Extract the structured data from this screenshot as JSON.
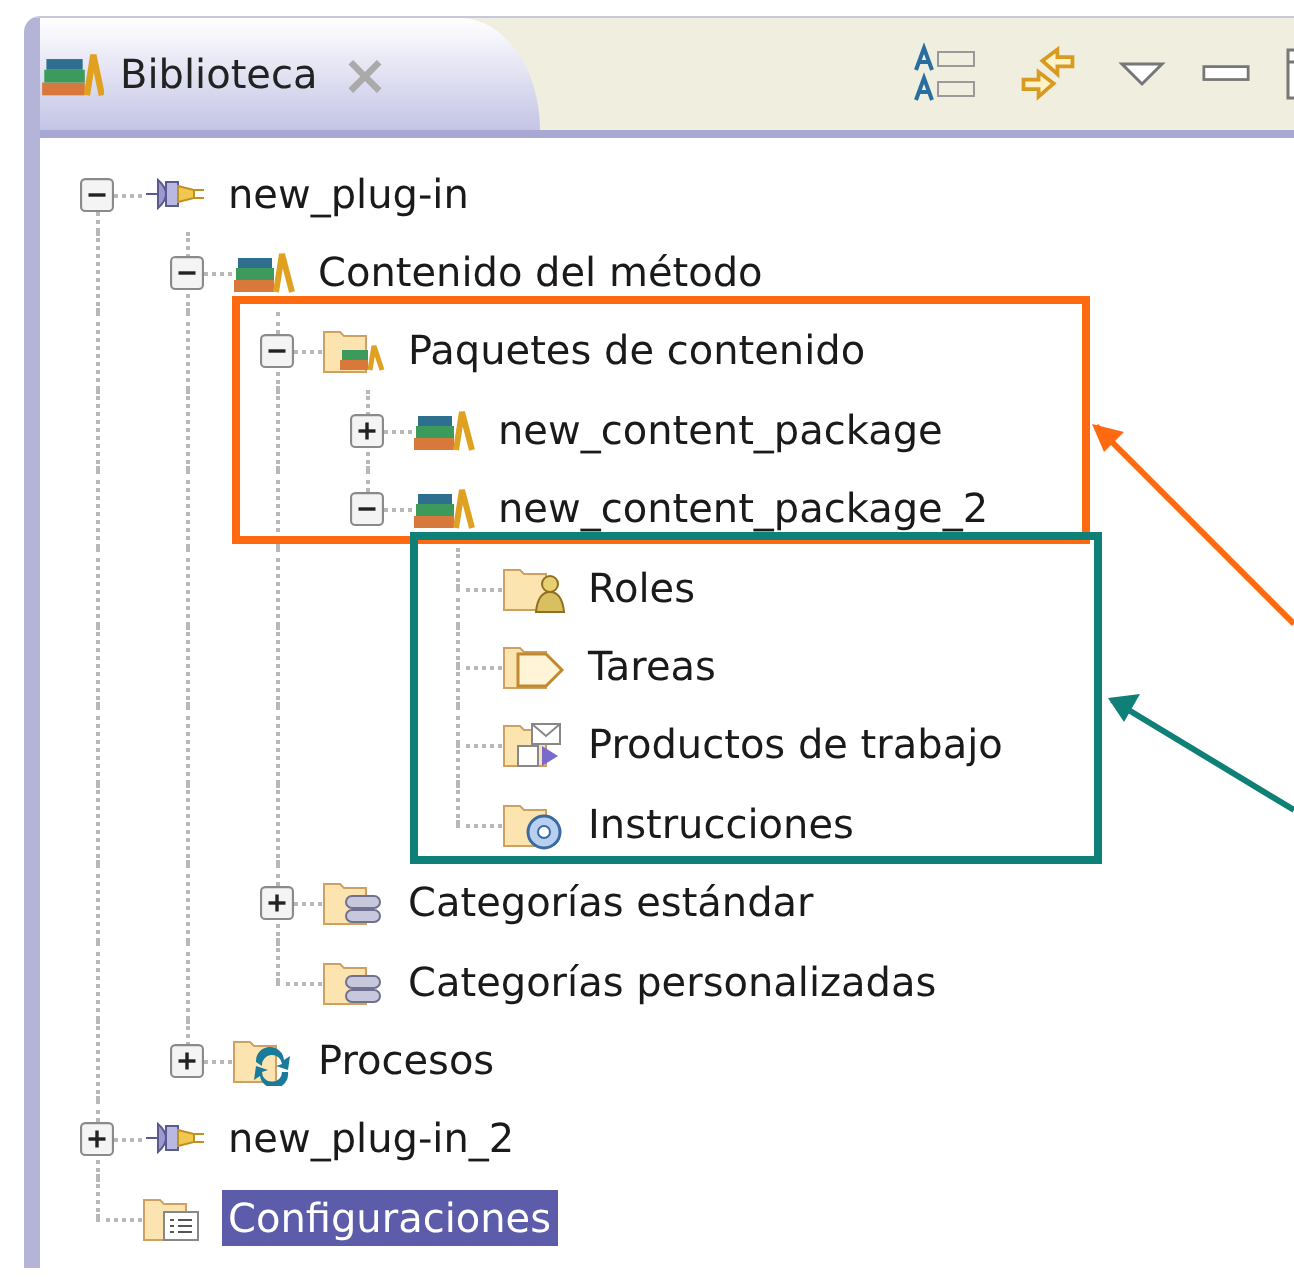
{
  "view_tab": {
    "title": "Biblioteca",
    "close": "×",
    "selected": true
  },
  "tree": [
    {
      "label": "new_plug-in",
      "kind": "plugin",
      "expanded": true,
      "selected": false,
      "children": [
        {
          "label": "Contenido del método",
          "kind": "content",
          "expanded": true,
          "selected": false,
          "children": [
            {
              "label": "Paquetes de contenido",
              "kind": "package-folder",
              "expanded": true,
              "selected": false,
              "children": [
                {
                  "label": "new_content_package",
                  "kind": "package",
                  "expanded": false,
                  "selected": false
                },
                {
                  "label": "new_content_package_2",
                  "kind": "package",
                  "expanded": true,
                  "selected": false,
                  "children": [
                    {
                      "label": "Roles",
                      "kind": "role-folder",
                      "selected": false
                    },
                    {
                      "label": "Tareas",
                      "kind": "task-folder",
                      "selected": false
                    },
                    {
                      "label": "Productos de trabajo",
                      "kind": "workproduct-folder",
                      "selected": false
                    },
                    {
                      "label": "Instrucciones",
                      "kind": "guidance-folder",
                      "selected": false
                    }
                  ]
                }
              ]
            },
            {
              "label": "Categorías estándar",
              "kind": "category-folder",
              "expanded": false,
              "selected": false
            },
            {
              "label": "Categorías personalizadas",
              "kind": "category-folder",
              "selected": false
            }
          ]
        },
        {
          "label": "Procesos",
          "kind": "process-folder",
          "expanded": false,
          "selected": false
        }
      ]
    },
    {
      "label": "new_plug-in_2",
      "kind": "plugin",
      "expanded": false,
      "selected": false
    },
    {
      "label": "Configuraciones",
      "kind": "config-folder",
      "selected": true
    }
  ],
  "callouts": [
    {
      "color": "#ff6a10"
    },
    {
      "color": "#0e8078"
    }
  ]
}
